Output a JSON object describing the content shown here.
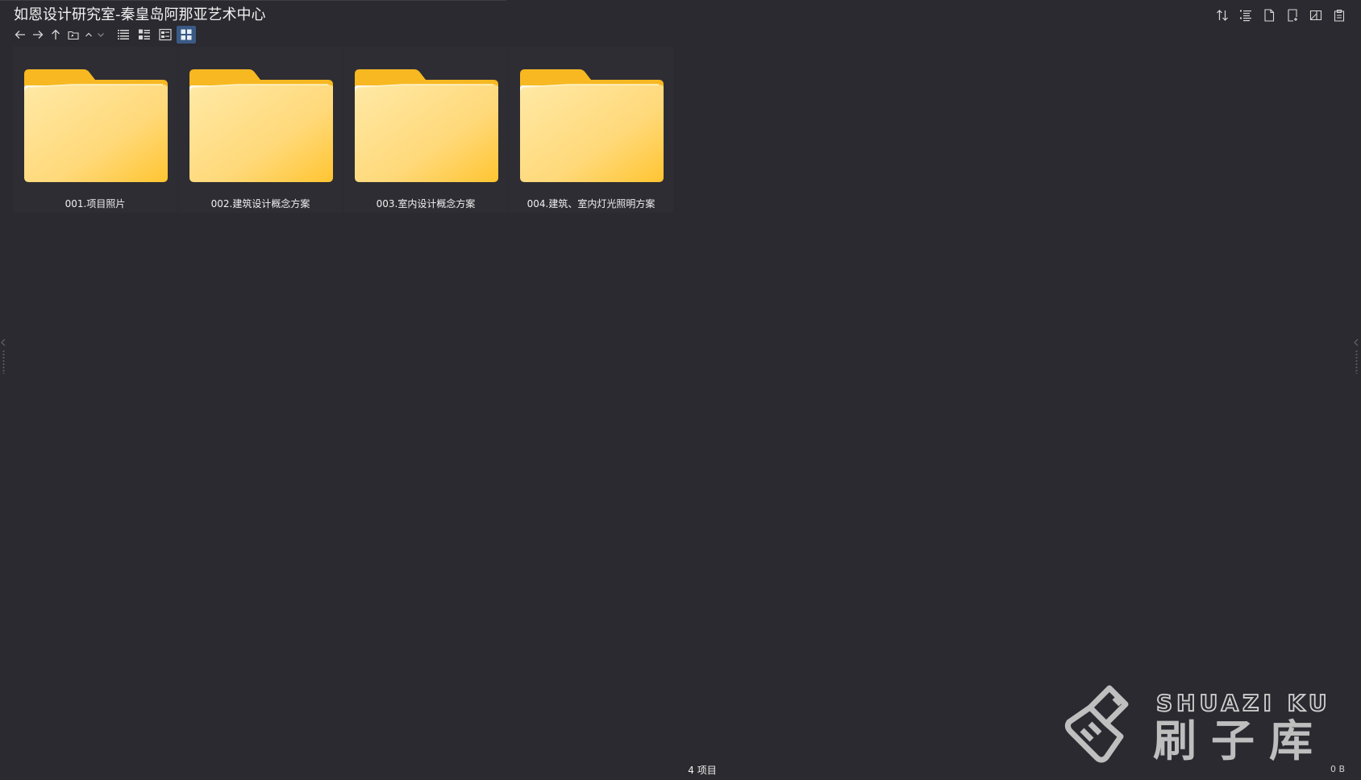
{
  "window": {
    "title": "如恩设计研究室-秦皇岛阿那亚艺术中心"
  },
  "toolbar": {
    "nav": [
      {
        "name": "back-button",
        "icon": "arrow-left-icon"
      },
      {
        "name": "forward-button",
        "icon": "arrow-right-icon"
      },
      {
        "name": "up-button",
        "icon": "arrow-up-icon"
      },
      {
        "name": "folder-button",
        "icon": "folder-icon"
      },
      {
        "name": "sort-up-button",
        "icon": "chevron-up-icon"
      },
      {
        "name": "sort-down-button",
        "icon": "chevron-down-icon"
      }
    ],
    "views": [
      {
        "name": "view-list-button",
        "icon": "list-icon",
        "active": false
      },
      {
        "name": "view-details-button",
        "icon": "details-icon",
        "active": false
      },
      {
        "name": "view-tiles-button",
        "icon": "tiles-icon",
        "active": false
      },
      {
        "name": "view-grid-button",
        "icon": "grid-icon",
        "active": true
      }
    ],
    "right": [
      {
        "name": "sort-button",
        "icon": "sort-arrows-icon"
      },
      {
        "name": "group-button",
        "icon": "grouping-icon"
      },
      {
        "name": "new-file-button",
        "icon": "new-file-icon"
      },
      {
        "name": "new-folder-button",
        "icon": "new-folder-icon"
      },
      {
        "name": "preview-pane-button",
        "icon": "preview-icon"
      },
      {
        "name": "clipboard-button",
        "icon": "clipboard-icon"
      }
    ]
  },
  "folders": [
    {
      "label": "001.项目照片"
    },
    {
      "label": "002.建筑设计概念方案"
    },
    {
      "label": "003.室内设计概念方案"
    },
    {
      "label": "004.建筑、室内灯光照明方案"
    }
  ],
  "status": {
    "item_count": "4 项目",
    "size": "0 B"
  },
  "watermark": {
    "latin": "SHUAZI KU",
    "chinese": "刷子库"
  },
  "colors": {
    "background": "#2b2a30",
    "tile": "#2e2d33",
    "active_view": "#3a5a86",
    "folder_front": "#ffd96b",
    "folder_back": "#f5b820"
  }
}
